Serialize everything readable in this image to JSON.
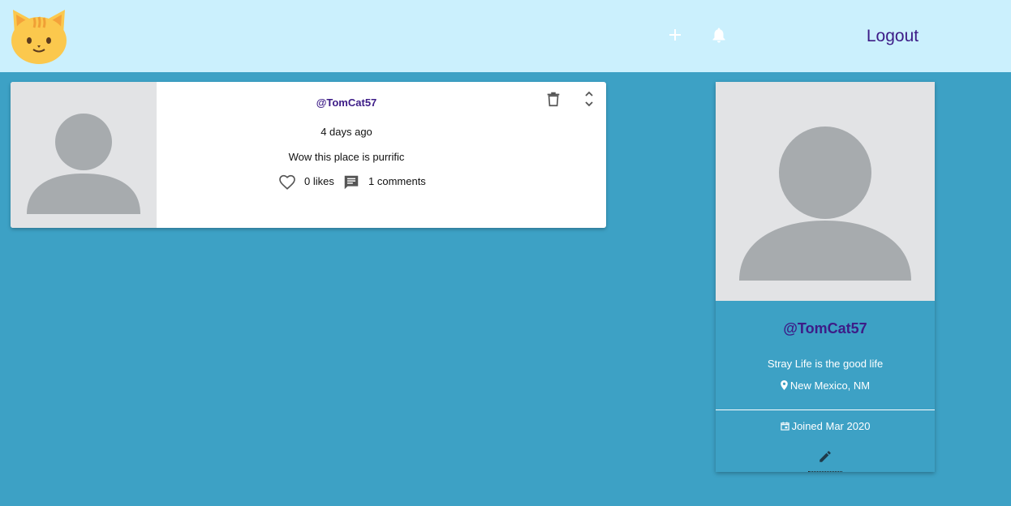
{
  "header": {
    "logout_label": "Logout"
  },
  "icons": {
    "logo": "cat-face-icon",
    "add": "plus-icon",
    "notifications": "bell-icon",
    "like": "heart-outline-icon",
    "comment": "comment-icon",
    "delete": "trash-icon",
    "expand": "unfold-icon",
    "location": "location-pin-icon",
    "calendar": "calendar-icon",
    "edit": "pencil-icon"
  },
  "post": {
    "user_handle": "@TomCat57",
    "time": "4 days ago",
    "body": "Wow this place is purrific",
    "likes_label": "0 likes",
    "comments_label": "1 comments"
  },
  "profile": {
    "handle": "@TomCat57",
    "bio": "Stray Life is the good life",
    "location": "New Mexico, NM",
    "joined": "Joined Mar 2020"
  },
  "colors": {
    "page_background": "#3da1c5",
    "header_background": "#cbf0fd",
    "brand_purple": "#3d1c87",
    "card_background": "#ffffff",
    "avatar_placeholder_bg": "#e2e3e5",
    "avatar_placeholder_fg": "#a7abae"
  }
}
